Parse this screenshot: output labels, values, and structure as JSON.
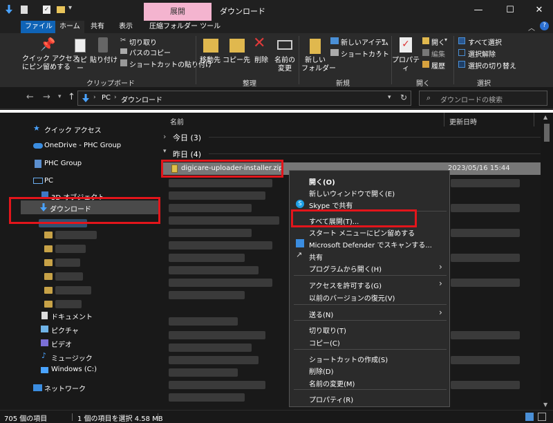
{
  "window": {
    "title": "ダウンロード",
    "context_tab": "展開"
  },
  "tabs": [
    "ファイル",
    "ホーム",
    "共有",
    "表示",
    "圧縮フォルダー ツール"
  ],
  "ribbon": {
    "pin": "クイック アクセス\nにピン留めする",
    "copy": "コピー",
    "paste": "貼り付け",
    "cut": "切り取り",
    "copy_path": "パスのコピー",
    "paste_shortcut": "ショートカットの貼り付け",
    "move_to": "移動先",
    "copy_to": "コピー先",
    "delete": "削除",
    "rename": "名前の\n変更",
    "new_folder": "新しい\nフォルダー",
    "new_item": "新しいアイテム",
    "shortcut": "ショートカット",
    "properties": "プロパティ",
    "open": "開く",
    "edit": "編集",
    "history": "履歴",
    "select_all": "すべて選択",
    "select_none": "選択解除",
    "invert": "選択の切り替え",
    "groups": [
      "クリップボード",
      "整理",
      "新規",
      "開く",
      "選択"
    ]
  },
  "address": {
    "path": [
      "PC",
      "ダウンロード"
    ],
    "search_placeholder": "ダウンロードの検索"
  },
  "sidebar": [
    "クイック アクセス",
    "OneDrive - PHC Group",
    "PHC Group",
    "PC",
    "3D オブジェクト",
    "ダウンロード",
    "ドキュメント",
    "ピクチャ",
    "ビデオ",
    "ミュージック",
    "Windows (C:)",
    "ネットワーク"
  ],
  "columns": {
    "name": "名前",
    "modified": "更新日時"
  },
  "groups": {
    "today": "今日 (3)",
    "yesterday": "昨日 (4)"
  },
  "file": {
    "name": "digicare-uploader-installer.zip",
    "date": "2023/05/16 15:44"
  },
  "context_menu": [
    "開く(O)",
    "新しいウィンドウで開く(E)",
    "Skype で共有",
    "すべて展開(T)...",
    "スタート メニューにピン留めする",
    "Microsoft Defender でスキャンする...",
    "共有",
    "プログラムから開く(H)",
    "アクセスを許可する(G)",
    "以前のバージョンの復元(V)",
    "送る(N)",
    "切り取り(T)",
    "コピー(C)",
    "ショートカットの作成(S)",
    "削除(D)",
    "名前の変更(M)",
    "プロパティ(R)"
  ],
  "status": {
    "count": "705 個の項目",
    "selected": "1 個の項目を選択 4.58 MB"
  },
  "colors": {
    "highlight": "#e3151b",
    "accent": "#0f63b6"
  }
}
